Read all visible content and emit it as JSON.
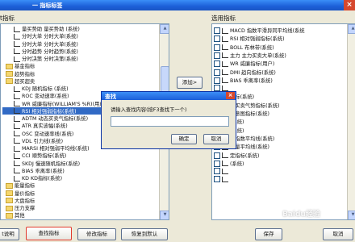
{
  "window": {
    "title": "一 指标标签",
    "close": "×"
  },
  "left_panel": {
    "label": "t指标",
    "items": [
      {
        "text": "量买势助 量买势助 (系统)",
        "icon": "line-chart-icon"
      },
      {
        "text": "分时大单 分时大单(系统)",
        "icon": "line-chart-icon"
      },
      {
        "text": "分时大单 分时大单(系统)",
        "icon": "line-chart-icon"
      },
      {
        "text": "分时趋势 分时趋势(系统)",
        "icon": "line-chart-icon"
      },
      {
        "text": "分时决策 分时决策(系统)",
        "icon": "line-chart-icon"
      },
      {
        "text": "基金指标",
        "icon": "folder-icon"
      },
      {
        "text": "趋势指标",
        "icon": "folder-icon"
      },
      {
        "text": "超买超卖",
        "icon": "folder-icon"
      },
      {
        "text": "KDJ 随机指标 (系统)",
        "icon": "line-chart-icon"
      },
      {
        "text": "ROC 变动速率(系统)",
        "icon": "line-chart-icon"
      },
      {
        "text": "WR 威廉指标(WILLIAM'S %R)(用户)",
        "icon": "line-chart-icon"
      },
      {
        "text": "RSI 相对强弱指标(系统)",
        "icon": "line-chart-icon",
        "selected": true
      },
      {
        "text": "ADTM 动态买卖气指标(系统)",
        "icon": "line-chart-icon"
      },
      {
        "text": "ATR 真实波幅(系统)",
        "icon": "line-chart-icon"
      },
      {
        "text": "OSC 变动速率线(系统)",
        "icon": "line-chart-icon"
      },
      {
        "text": "VDL 引力线(系统)",
        "icon": "line-chart-icon"
      },
      {
        "text": "MARSI 相对强弱平均线(系统)",
        "icon": "line-chart-icon"
      },
      {
        "text": "CCI 顺势指标(系统)",
        "icon": "line-chart-icon"
      },
      {
        "text": "SKDJ 慢速随机指标(系统)",
        "icon": "line-chart-icon"
      },
      {
        "text": "BIAS 乖离率(系统)",
        "icon": "line-chart-icon"
      },
      {
        "text": "KD KD指标(系统)",
        "icon": "line-chart-icon"
      },
      {
        "text": "能量指标",
        "icon": "folder-icon"
      },
      {
        "text": "量价指标",
        "icon": "folder-icon"
      },
      {
        "text": "大盘指标",
        "icon": "folder-icon"
      },
      {
        "text": "压力支撑",
        "icon": "folder-icon"
      },
      {
        "text": "其他",
        "icon": "folder-icon"
      }
    ]
  },
  "right_panel": {
    "label": "选用指标",
    "items": [
      {
        "text": "MACD 指数平滑异同平均线(系统"
      },
      {
        "text": "RSI 相对强弱指标(系统)"
      },
      {
        "text": "BOLL 布林带(系统)"
      },
      {
        "text": "主力 主力买卖大单(系统)"
      },
      {
        "text": "WR 威廉指标(用户)"
      },
      {
        "text": "DMI 趋向指标(系统)"
      },
      {
        "text": "BIAS 乖离率(系统)"
      },
      {
        "text": ""
      },
      {
        "text": "指标(系统)"
      },
      {
        "text": "转买卖气势指标(系统)"
      },
      {
        "text": "气意图指标(系统)"
      },
      {
        "text": "(系统)"
      },
      {
        "text": "(系统)"
      },
      {
        "text": "重指数平均线(系统)"
      },
      {
        "text": "数量平均线(系统)"
      },
      {
        "text": "定指标(系统)"
      },
      {
        "text": "(系统)"
      },
      {
        "text": ""
      },
      {
        "text": ""
      }
    ]
  },
  "buttons": {
    "add": "添加>",
    "explain": "t说明",
    "find": "查找指标",
    "modify": "修改指标",
    "restore": "恢复到默认",
    "save": "保存",
    "cancel": "取消"
  },
  "find_dialog": {
    "title": "查找",
    "prompt": "请输入查找内容(按F3查找下一个)",
    "input_value": "",
    "ok": "确定",
    "cancel": "取消",
    "close": "×"
  },
  "watermark": "Baidu经验"
}
